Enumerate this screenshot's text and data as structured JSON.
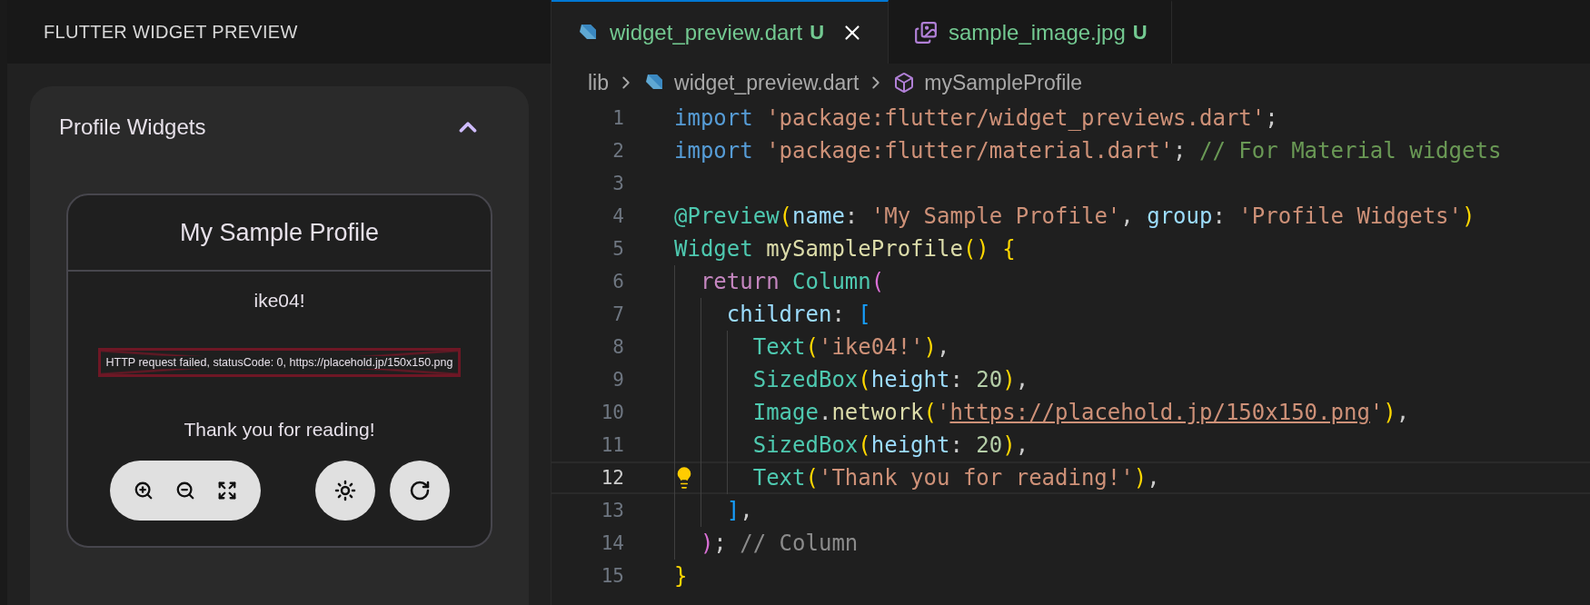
{
  "preview_panel": {
    "title": "FLUTTER WIDGET PREVIEW",
    "group": {
      "label": "Profile Widgets",
      "expanded": true,
      "preview": {
        "title": "My Sample Profile",
        "greeting": "ike04!",
        "image_error": "HTTP request failed, statusCode: 0, https://placehold.jp/150x150.png",
        "footer": "Thank you for reading!",
        "zoom_controls": [
          {
            "kind": "zoom-in"
          },
          {
            "kind": "zoom-out"
          },
          {
            "kind": "fit"
          }
        ],
        "actions": [
          {
            "kind": "brightness"
          },
          {
            "kind": "refresh"
          }
        ]
      }
    }
  },
  "editor": {
    "tabs": [
      {
        "kind": "dart",
        "label": "widget_preview.dart",
        "badge": "U",
        "selected": true
      },
      {
        "kind": "image",
        "label": "sample_image.jpg",
        "badge": "U",
        "selected": false
      }
    ],
    "breadcrumb": [
      {
        "kind": "folder",
        "label": "lib"
      },
      {
        "kind": "dart",
        "label": "widget_preview.dart"
      },
      {
        "kind": "symbol",
        "label": "mySampleProfile"
      }
    ],
    "lines": [
      {
        "number": "1",
        "current": false,
        "tokens": [
          {
            "kind": "keyword",
            "text": "import "
          },
          {
            "kind": "string",
            "text": "'package:flutter/widget_previews.dart'"
          },
          {
            "kind": "punct",
            "text": ";"
          }
        ]
      },
      {
        "number": "2",
        "current": false,
        "tokens": [
          {
            "kind": "keyword",
            "text": "import "
          },
          {
            "kind": "string",
            "text": "'package:flutter/material.dart'"
          },
          {
            "kind": "punct",
            "text": "; "
          },
          {
            "kind": "comment",
            "text": "// For Material widgets"
          }
        ]
      },
      {
        "number": "3",
        "current": false
      },
      {
        "number": "4",
        "current": false,
        "tokens": [
          {
            "kind": "type",
            "text": "@Preview"
          },
          {
            "kind": "bracket1",
            "text": "("
          },
          {
            "kind": "param",
            "text": "name"
          },
          {
            "kind": "punct",
            "text": ": "
          },
          {
            "kind": "string",
            "text": "'My Sample Profile'"
          },
          {
            "kind": "punct",
            "text": ", "
          },
          {
            "kind": "param",
            "text": "group"
          },
          {
            "kind": "punct",
            "text": ": "
          },
          {
            "kind": "string",
            "text": "'Profile Widgets'"
          },
          {
            "kind": "bracket1",
            "text": ")"
          }
        ]
      },
      {
        "number": "5",
        "current": false,
        "tokens": [
          {
            "kind": "type",
            "text": "Widget "
          },
          {
            "kind": "func",
            "text": "mySampleProfile"
          },
          {
            "kind": "bracket1",
            "text": "() {"
          }
        ],
        "children": [
          {
            "number": "6",
            "current": false,
            "tokens": [
              {
                "kind": "control",
                "text": "return "
              },
              {
                "kind": "type",
                "text": "Column"
              },
              {
                "kind": "bracket2",
                "text": "("
              }
            ],
            "children": [
              {
                "number": "7",
                "current": false,
                "tokens": [
                  {
                    "kind": "param",
                    "text": "children"
                  },
                  {
                    "kind": "punct",
                    "text": ": "
                  },
                  {
                    "kind": "bracket3",
                    "text": "["
                  }
                ],
                "children": [
                  {
                    "number": "8",
                    "current": false,
                    "tokens": [
                      {
                        "kind": "type",
                        "text": "Text"
                      },
                      {
                        "kind": "bracket1",
                        "text": "("
                      },
                      {
                        "kind": "string",
                        "text": "'ike04!'"
                      },
                      {
                        "kind": "bracket1",
                        "text": ")"
                      },
                      {
                        "kind": "punct",
                        "text": ","
                      }
                    ]
                  },
                  {
                    "number": "9",
                    "current": false,
                    "tokens": [
                      {
                        "kind": "type",
                        "text": "SizedBox"
                      },
                      {
                        "kind": "bracket1",
                        "text": "("
                      },
                      {
                        "kind": "param",
                        "text": "height"
                      },
                      {
                        "kind": "punct",
                        "text": ": "
                      },
                      {
                        "kind": "number",
                        "text": "20"
                      },
                      {
                        "kind": "bracket1",
                        "text": ")"
                      },
                      {
                        "kind": "punct",
                        "text": ","
                      }
                    ]
                  },
                  {
                    "number": "10",
                    "current": false,
                    "tokens": [
                      {
                        "kind": "type",
                        "text": "Image"
                      },
                      {
                        "kind": "punct",
                        "text": "."
                      },
                      {
                        "kind": "func",
                        "text": "network"
                      },
                      {
                        "kind": "bracket1",
                        "text": "("
                      },
                      {
                        "kind": "string",
                        "text": "'"
                      },
                      {
                        "kind": "link",
                        "text": "https://placehold.jp/150x150.png"
                      },
                      {
                        "kind": "string",
                        "text": "'"
                      },
                      {
                        "kind": "bracket1",
                        "text": ")"
                      },
                      {
                        "kind": "punct",
                        "text": ","
                      }
                    ]
                  },
                  {
                    "number": "11",
                    "current": false,
                    "tokens": [
                      {
                        "kind": "type",
                        "text": "SizedBox"
                      },
                      {
                        "kind": "bracket1",
                        "text": "("
                      },
                      {
                        "kind": "param",
                        "text": "height"
                      },
                      {
                        "kind": "punct",
                        "text": ": "
                      },
                      {
                        "kind": "number",
                        "text": "20"
                      },
                      {
                        "kind": "bracket1",
                        "text": ")"
                      },
                      {
                        "kind": "punct",
                        "text": ","
                      }
                    ]
                  },
                  {
                    "number": "12",
                    "current": true,
                    "tokens": [
                      {
                        "kind": "type",
                        "text": "Text"
                      },
                      {
                        "kind": "bracket1",
                        "text": "("
                      },
                      {
                        "kind": "string",
                        "text": "'Thank you for reading!'"
                      },
                      {
                        "kind": "bracket1",
                        "text": ")"
                      },
                      {
                        "kind": "punct",
                        "text": ","
                      }
                    ]
                  }
                ]
              },
              {
                "number": "13",
                "current": false,
                "tokens": [
                  {
                    "kind": "bracket3",
                    "text": "]"
                  },
                  {
                    "kind": "punct",
                    "text": ","
                  }
                ]
              }
            ]
          },
          {
            "number": "14",
            "current": false,
            "tokens": [
              {
                "kind": "bracket2",
                "text": ")"
              },
              {
                "kind": "punct",
                "text": "; "
              },
              {
                "kind": "label",
                "text": "// Column"
              }
            ]
          }
        ]
      },
      {
        "number": "15",
        "current": false,
        "tokens": [
          {
            "kind": "bracket1",
            "text": "}"
          }
        ]
      }
    ]
  }
}
